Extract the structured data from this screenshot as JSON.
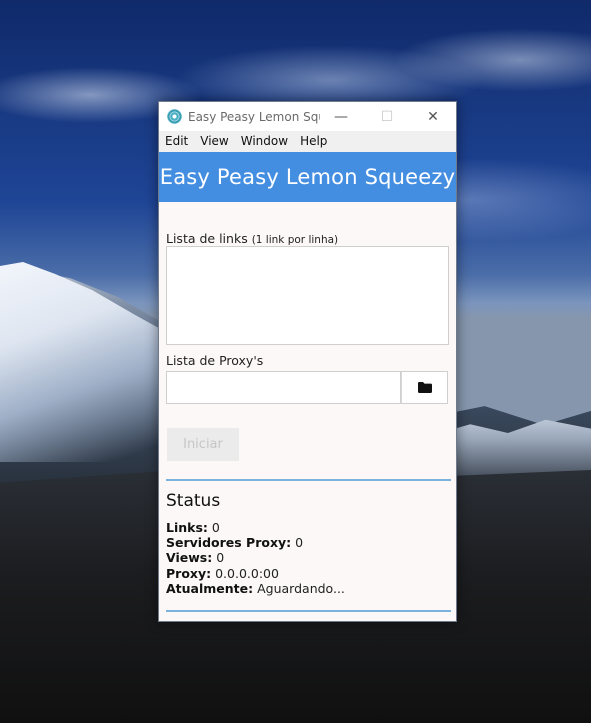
{
  "window": {
    "title": "Easy Peasy Lemon Squ...",
    "controls": {
      "minimize": "—",
      "maximize": "☐",
      "close": "✕"
    }
  },
  "menu": [
    "Edit",
    "View",
    "Window",
    "Help"
  ],
  "header": {
    "title": "Easy Peasy Lemon Squeezy"
  },
  "links": {
    "label": "Lista de links",
    "hint": "(1 link por linha)",
    "value": ""
  },
  "proxy": {
    "label": "Lista de Proxy's",
    "value": "",
    "folder_icon": "folder-icon"
  },
  "start_button": {
    "label": "Iniciar",
    "enabled": false
  },
  "status": {
    "title": "Status",
    "items": [
      {
        "key": "Links:",
        "value": "0"
      },
      {
        "key": "Servidores Proxy:",
        "value": "0"
      },
      {
        "key": "Views:",
        "value": "0"
      },
      {
        "key": "Proxy:",
        "value": "0.0.0.0:00"
      },
      {
        "key": "Atualmente:",
        "value": "Aguardando..."
      }
    ]
  },
  "colors": {
    "header_bg": "#448ee2",
    "divider": "#7cb2de",
    "window_bg": "#fcf8f7"
  }
}
